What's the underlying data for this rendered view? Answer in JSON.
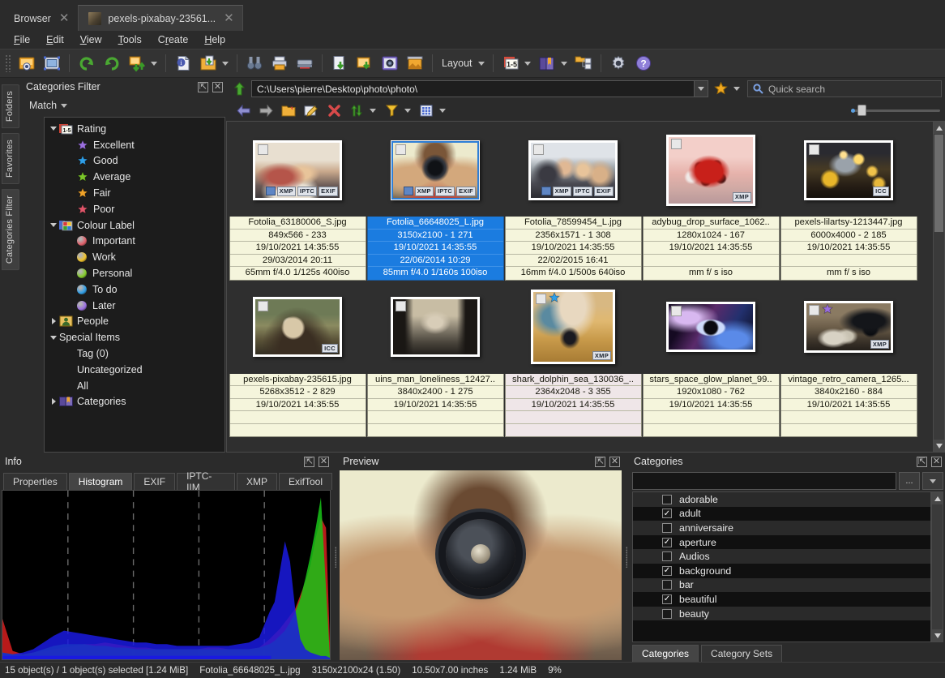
{
  "window": {
    "tabs": [
      {
        "label": "Browser",
        "active": false,
        "has_icon": false,
        "close": "✕"
      },
      {
        "label": "pexels-pixabay-23561...",
        "active": true,
        "has_icon": true,
        "close": "✕"
      }
    ]
  },
  "menu": {
    "items": [
      "File",
      "Edit",
      "View",
      "Tools",
      "Create",
      "Help"
    ]
  },
  "toolbar": {
    "icons": [
      "open-image-icon",
      "save-image-icon",
      "rotate-left-icon",
      "rotate-right-icon",
      "convert-image-icon",
      "info-icon",
      "export-folder-icon",
      "find-duplicates-icon",
      "print-icon",
      "scanner-icon",
      "batch-convert-icon",
      "batch-rename-icon",
      "screen-capture-icon",
      "slideshow-icon"
    ],
    "layout_label": "Layout",
    "right_icons": [
      "rating-1-5-icon",
      "catalog-book-icon",
      "folder-tree-icon",
      "settings-gear-icon",
      "help-icon"
    ]
  },
  "left_vtabs": [
    {
      "label": "Folders",
      "selected": false
    },
    {
      "label": "Favorites",
      "selected": false
    },
    {
      "label": "Categories Filter",
      "selected": true
    }
  ],
  "categories_filter_panel": {
    "title": "Categories Filter",
    "match_label": "Match",
    "header_icons": [
      "float-panel-icon",
      "close-panel-icon"
    ],
    "tree": [
      {
        "label": "Rating",
        "level": 0,
        "twisty": "down",
        "icon": "rating-1-5-icon"
      },
      {
        "label": "Excellent",
        "level": 1,
        "marker": "star",
        "color": "#9b6fe0"
      },
      {
        "label": "Good",
        "level": 1,
        "marker": "star",
        "color": "#2f9fe8"
      },
      {
        "label": "Average",
        "level": 1,
        "marker": "star",
        "color": "#7bc62a"
      },
      {
        "label": "Fair",
        "level": 1,
        "marker": "star",
        "color": "#f0a32a"
      },
      {
        "label": "Poor",
        "level": 1,
        "marker": "star",
        "color": "#e0566a"
      },
      {
        "label": "Colour Label",
        "level": 0,
        "twisty": "down",
        "icon": "colour-label-icon"
      },
      {
        "label": "Important",
        "level": 1,
        "marker": "dot",
        "color": "#e0606a"
      },
      {
        "label": "Work",
        "level": 1,
        "marker": "dot",
        "color": "#f0c22a"
      },
      {
        "label": "Personal",
        "level": 1,
        "marker": "dot",
        "color": "#84cc2a"
      },
      {
        "label": "To do",
        "level": 1,
        "marker": "dot",
        "color": "#2f9fe8"
      },
      {
        "label": "Later",
        "level": 1,
        "marker": "dot",
        "color": "#9b6fe0"
      },
      {
        "label": "People",
        "level": 0,
        "twisty": "right",
        "icon": "people-icon"
      },
      {
        "label": "Special Items",
        "level": 0,
        "twisty": "down"
      },
      {
        "label": "Tag (0)",
        "level": 1
      },
      {
        "label": "Uncategorized",
        "level": 1
      },
      {
        "label": "All",
        "level": 1
      },
      {
        "label": "Categories",
        "level": 0,
        "twisty": "right",
        "icon": "catalog-book-icon"
      }
    ]
  },
  "address_bar": {
    "up_icon": "up-folder-icon",
    "path": "C:\\Users\\pierre\\Desktop\\photo\\photo\\",
    "favorite_icon": "star-favorite-icon",
    "search_icon": "search-icon",
    "search_placeholder": "Quick search"
  },
  "browser_toolbar": {
    "icons": [
      "back-arrow-icon",
      "forward-arrow-icon",
      "new-folder-icon",
      "rename-icon",
      "delete-icon",
      "sort-icon",
      "filter-icon",
      "view-mode-icon"
    ],
    "zoom_slider_value": 9
  },
  "thumbnails": [
    {
      "name": "Fotolia_63180006_S.jpg",
      "dimensions": "849x566 - 233",
      "date_modified": "19/10/2021 14:35:55",
      "date_taken": "29/03/2014 20:11",
      "exif": "65mm f/4.0 1/125s 400iso",
      "selected": false,
      "hover": false,
      "badges": [
        "img",
        "XMP",
        "IPTC",
        "EXIF"
      ],
      "color_star": null,
      "image": "two-women-coffee-photo"
    },
    {
      "name": "Fotolia_66648025_L.jpg",
      "dimensions": "3150x2100 - 1 271",
      "date_modified": "19/10/2021 14:35:55",
      "date_taken": "22/06/2014 10:29",
      "exif": "85mm f/4.0 1/160s 100iso",
      "selected": true,
      "hover": false,
      "badges": [
        "img",
        "XMP",
        "IPTC",
        "EXIF"
      ],
      "color_star": null,
      "image": "woman-camera-lens-photo"
    },
    {
      "name": "Fotolia_78599454_L.jpg",
      "dimensions": "2356x1571 - 1 308",
      "date_modified": "19/10/2021 14:35:55",
      "date_taken": "22/02/2015 16:41",
      "exif": "16mm f/4.0 1/500s 640iso",
      "selected": false,
      "hover": false,
      "badges": [
        "img",
        "XMP",
        "IPTC",
        "EXIF"
      ],
      "color_star": null,
      "image": "group-friends-selfie-photo"
    },
    {
      "name": "adybug_drop_surface_1062..",
      "dimensions": "1280x1024 - 167",
      "date_modified": "19/10/2021 14:35:55",
      "date_taken": "",
      "exif": "mm f/ s iso",
      "selected": false,
      "hover": false,
      "badges": [
        "XMP"
      ],
      "color_star": null,
      "image": "ladybug-pink-photo"
    },
    {
      "name": "pexels-lilartsy-1213447.jpg",
      "dimensions": "6000x4000 - 2 185",
      "date_modified": "19/10/2021 14:35:55",
      "date_taken": "",
      "exif": "mm f/ s iso",
      "selected": false,
      "hover": false,
      "badges": [
        "ICC"
      ],
      "color_star": null,
      "image": "golden-bokeh-photo"
    },
    {
      "name": "pexels-pixabay-235615.jpg",
      "dimensions": "5268x3512 - 2 829",
      "date_modified": "19/10/2021 14:35:55",
      "date_taken": "",
      "exif": "",
      "selected": false,
      "hover": false,
      "badges": [
        "ICC"
      ],
      "color_star": null,
      "image": "crystal-ball-photo"
    },
    {
      "name": "uins_man_loneliness_12427..",
      "dimensions": "3840x2400 - 1 275",
      "date_modified": "19/10/2021 14:35:55",
      "date_taken": "",
      "exif": "",
      "selected": false,
      "hover": false,
      "badges": [],
      "color_star": null,
      "image": "ruins-man-photo"
    },
    {
      "name": "shark_dolphin_sea_130036_..",
      "dimensions": "2364x2048 - 3 355",
      "date_modified": "19/10/2021 14:35:55",
      "date_taken": "",
      "exif": "",
      "selected": false,
      "hover": true,
      "badges": [
        "XMP"
      ],
      "color_star": "#2f9fe8",
      "image": "dolphin-golden-sea-photo"
    },
    {
      "name": "stars_space_glow_planet_99..",
      "dimensions": "1920x1080 - 762",
      "date_modified": "19/10/2021 14:35:55",
      "date_taken": "",
      "exif": "",
      "selected": false,
      "hover": false,
      "badges": [],
      "color_star": null,
      "image": "space-planet-photo"
    },
    {
      "name": "vintage_retro_camera_1265...",
      "dimensions": "3840x2160 - 884",
      "date_modified": "19/10/2021 14:35:55",
      "date_taken": "",
      "exif": "",
      "selected": false,
      "hover": false,
      "badges": [
        "XMP"
      ],
      "color_star": "#9b6fe0",
      "image": "vintage-camera-photos"
    }
  ],
  "info_panel": {
    "title": "Info",
    "header_icons": [
      "float-panel-icon",
      "close-panel-icon"
    ],
    "tabs": [
      {
        "label": "Properties",
        "active": false
      },
      {
        "label": "Histogram",
        "active": true
      },
      {
        "label": "EXIF",
        "active": false
      },
      {
        "label": "IPTC-IIM",
        "active": false
      },
      {
        "label": "XMP",
        "active": false
      },
      {
        "label": "ExifTool",
        "active": false
      }
    ]
  },
  "chart_data": {
    "type": "area",
    "title": "Histogram",
    "xlabel": "",
    "ylabel": "",
    "xlim": [
      0,
      255
    ],
    "ylim": [
      0,
      100
    ],
    "grid": true,
    "gridlines_x": [
      51,
      102,
      153,
      204
    ],
    "legend": "none",
    "x": [
      0,
      8,
      16,
      24,
      32,
      40,
      48,
      56,
      64,
      72,
      80,
      88,
      96,
      104,
      112,
      120,
      128,
      136,
      144,
      152,
      160,
      168,
      176,
      184,
      192,
      200,
      208,
      212,
      216,
      220,
      224,
      228,
      232,
      236,
      240,
      244,
      248,
      252,
      255
    ],
    "series": [
      {
        "name": "Red",
        "color": "#d81f1f",
        "values": [
          24,
          5,
          3,
          4,
          5,
          6,
          7,
          8,
          9,
          9,
          10,
          9,
          8,
          7,
          7,
          6,
          6,
          6,
          6,
          6,
          7,
          7,
          6,
          6,
          6,
          7,
          12,
          15,
          18,
          22,
          26,
          30,
          38,
          46,
          56,
          72,
          84,
          78,
          10
        ]
      },
      {
        "name": "Green",
        "color": "#17c417",
        "values": [
          4,
          3,
          3,
          4,
          6,
          8,
          9,
          9,
          9,
          8,
          8,
          7,
          7,
          6,
          6,
          6,
          6,
          6,
          6,
          6,
          6,
          6,
          6,
          6,
          6,
          7,
          9,
          11,
          14,
          17,
          22,
          28,
          36,
          48,
          62,
          78,
          96,
          42,
          2
        ]
      },
      {
        "name": "Blue",
        "color": "#1a1ae0",
        "values": [
          4,
          3,
          4,
          6,
          10,
          14,
          17,
          16,
          15,
          14,
          13,
          12,
          11,
          10,
          10,
          9,
          9,
          8,
          8,
          8,
          8,
          8,
          8,
          9,
          10,
          13,
          28,
          34,
          52,
          70,
          58,
          30,
          12,
          6,
          4,
          3,
          2,
          2,
          1
        ]
      }
    ]
  },
  "preview_panel": {
    "title": "Preview",
    "header_icons": [
      "float-panel-icon",
      "close-panel-icon"
    ],
    "image": "woman-camera-lens-photo"
  },
  "categories_panel": {
    "title": "Categories",
    "header_icons": [
      "float-panel-icon",
      "close-panel-icon"
    ],
    "search_value": "",
    "more_button": "...",
    "dropdown_icon": "chevron-down-icon",
    "items": [
      {
        "label": "adorable",
        "checked": false
      },
      {
        "label": "adult",
        "checked": true
      },
      {
        "label": "anniversaire",
        "checked": false
      },
      {
        "label": "aperture",
        "checked": true
      },
      {
        "label": "Audios",
        "checked": false
      },
      {
        "label": "background",
        "checked": true
      },
      {
        "label": "bar",
        "checked": false
      },
      {
        "label": "beautiful",
        "checked": true
      },
      {
        "label": "beauty",
        "checked": false
      }
    ],
    "tabs": [
      {
        "label": "Categories",
        "active": true
      },
      {
        "label": "Category Sets",
        "active": false
      }
    ]
  },
  "status_bar": {
    "objects": "15 object(s) / 1 object(s) selected [1.24 MiB]",
    "filename": "Fotolia_66648025_L.jpg",
    "dimensions": "3150x2100x24 (1.50)",
    "inches": "10.50x7.00 inches",
    "size": "1.24 MiB",
    "zoom": "9%"
  }
}
